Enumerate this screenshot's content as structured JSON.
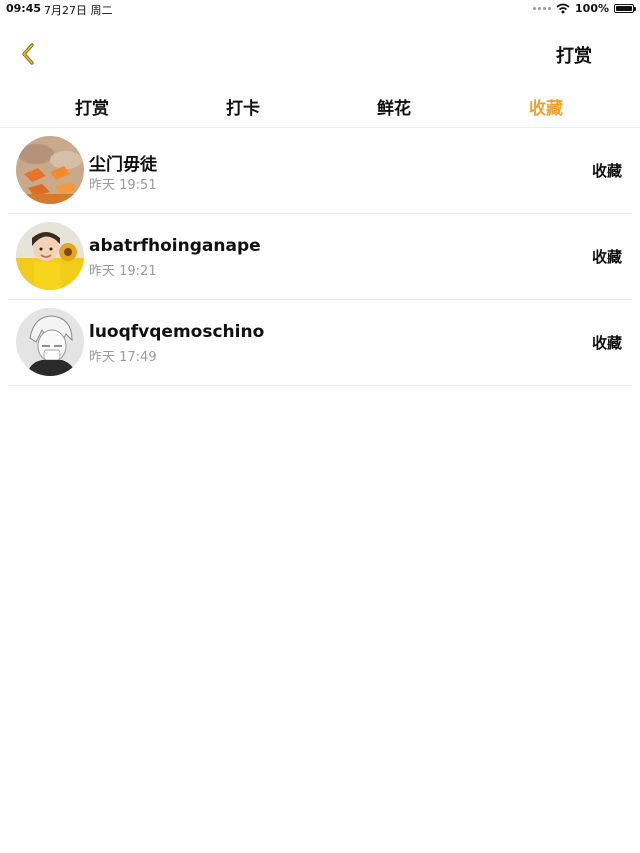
{
  "status_bar": {
    "time": "09:45",
    "date": "7月27日 周二",
    "battery": "100%",
    "battery_level": 1.0,
    "icons": [
      "signal-dots-icon",
      "wifi-icon",
      "battery-icon"
    ]
  },
  "nav": {
    "back_icon": "chevron-left-icon",
    "title": "打赏"
  },
  "tabs": [
    {
      "label": "打赏",
      "active": false
    },
    {
      "label": "打卡",
      "active": false
    },
    {
      "label": "鲜花",
      "active": false
    },
    {
      "label": "收藏",
      "active": true
    }
  ],
  "list": [
    {
      "name": "尘门毋徒",
      "time": "昨天 19:51",
      "action": "收藏",
      "avatar": "autumn-leaves-avatar"
    },
    {
      "name": "abatrfhoinganape",
      "time": "昨天 19:21",
      "action": "收藏",
      "avatar": "child-sunflower-avatar"
    },
    {
      "name": "luoqfvqemoschino",
      "time": "昨天 17:49",
      "action": "收藏",
      "avatar": "anime-sketch-avatar"
    }
  ],
  "colors": {
    "accent": "#f0a032",
    "text": "#111111",
    "secondary_text": "#9a9a9a",
    "divider": "#ececec"
  }
}
